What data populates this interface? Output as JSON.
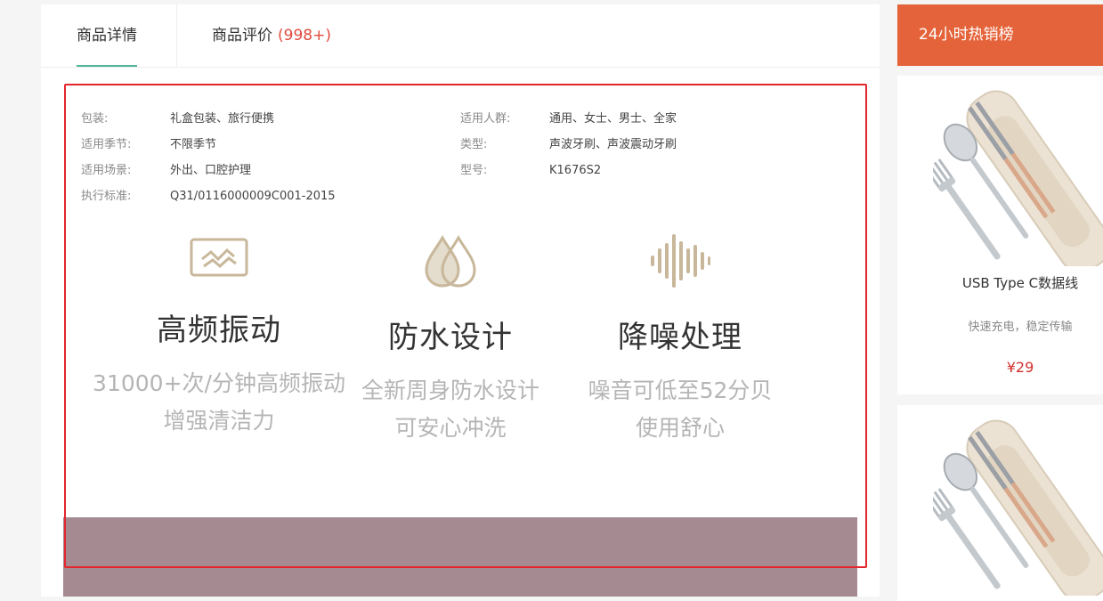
{
  "tabs": {
    "details": "商品详情",
    "reviews": "商品评价",
    "reviews_count": "(998+)"
  },
  "specs": {
    "left": [
      {
        "label": "包装:",
        "value": "礼盒包装、旅行便携"
      },
      {
        "label": "适用季节:",
        "value": "不限季节"
      },
      {
        "label": "适用场景:",
        "value": "外出、口腔护理"
      },
      {
        "label": "执行标准:",
        "value": "Q31/0116000009C001-2015"
      }
    ],
    "right": [
      {
        "label": "适用人群:",
        "value": "通用、女士、男士、全家"
      },
      {
        "label": "类型:",
        "value": "声波牙刷、声波震动牙刷"
      },
      {
        "label": "型号:",
        "value": "K1676S2"
      }
    ]
  },
  "features": [
    {
      "icon": "vibration-icon",
      "title": "高频振动",
      "line1": "31000+次/分钟高频振动",
      "line2": "增强清洁力"
    },
    {
      "icon": "water-drops-icon",
      "title": "防水设计",
      "line1": "全新周身防水设计",
      "line2": "可安心冲洗"
    },
    {
      "icon": "sound-wave-icon",
      "title": "降噪处理",
      "line1": "噪音可低至52分贝",
      "line2": "使用舒心"
    }
  ],
  "sidebar": {
    "title": "24小时热销榜",
    "products": [
      {
        "name": "USB Type C数据线",
        "desc": "快速充电，稳定传输",
        "price": "¥29"
      },
      {
        "name": "",
        "desc": "",
        "price": ""
      }
    ]
  },
  "colors": {
    "accent_tab": "#4fb59a",
    "count": "#e04a3e",
    "sidebar_head": "#e5633a",
    "highlight": "#e3262d",
    "price": "#d0312d",
    "icon": "#c8b79a"
  }
}
